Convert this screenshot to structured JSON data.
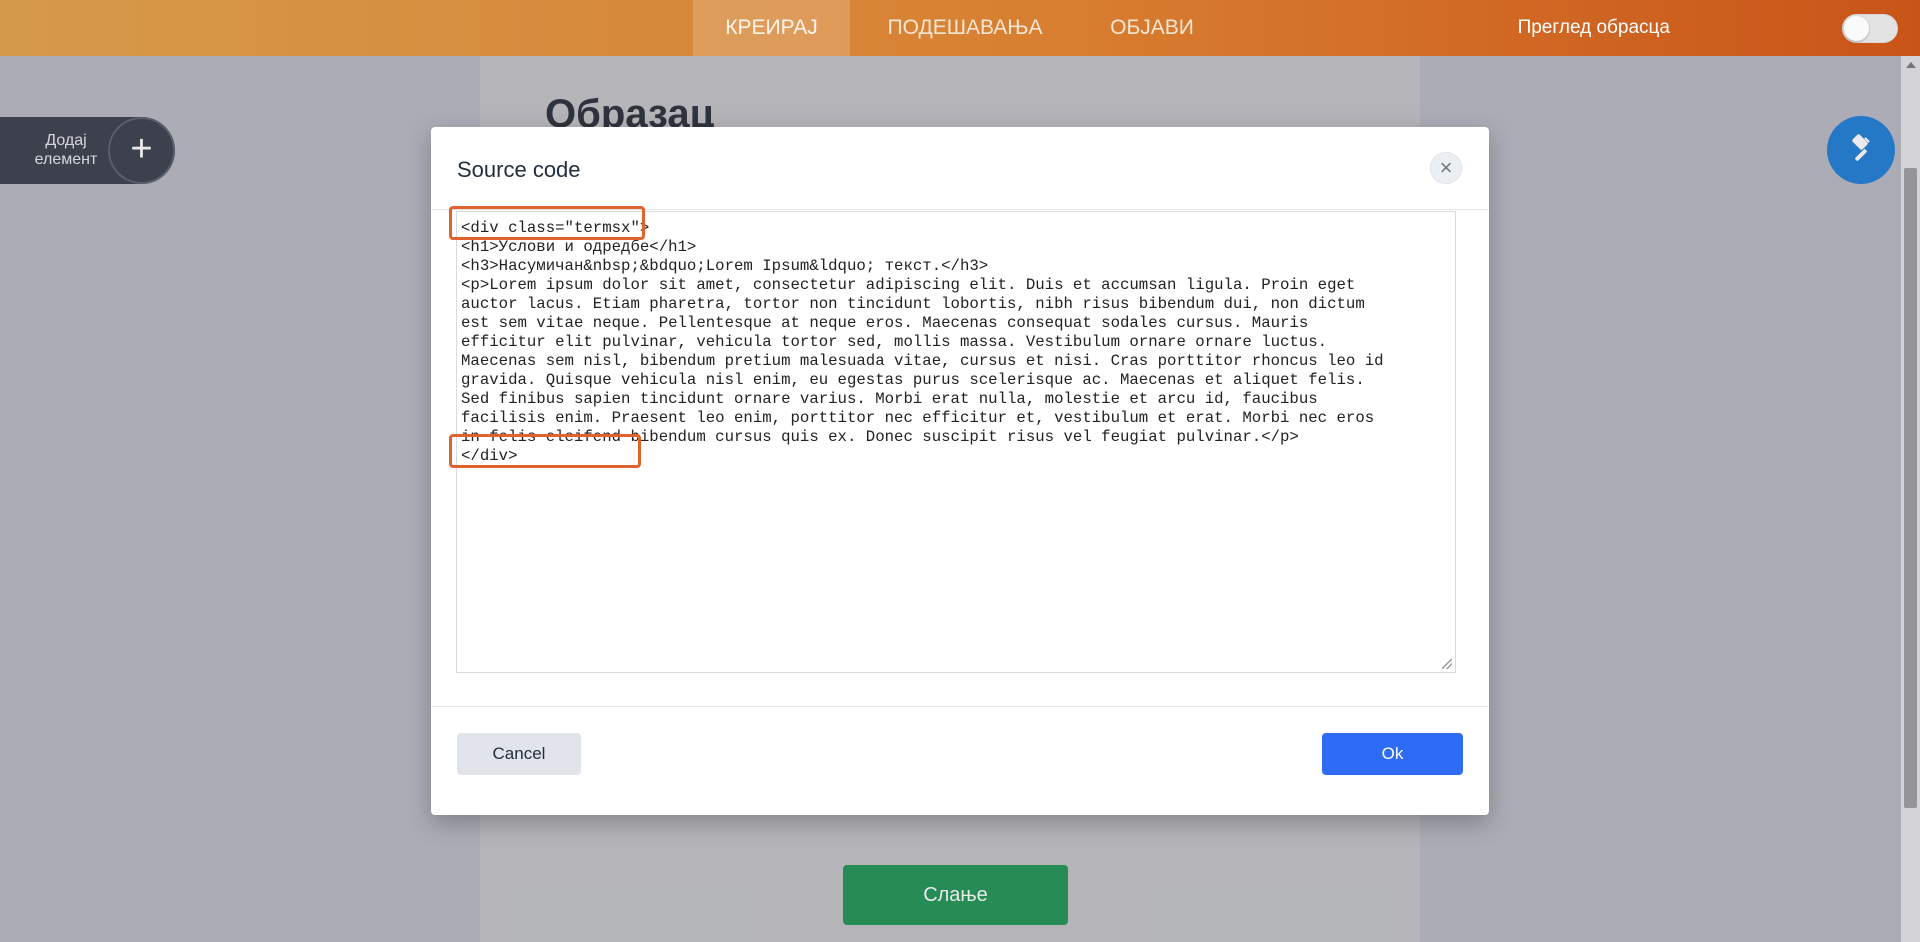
{
  "topbar": {
    "tabs": [
      {
        "label": "КРЕИРАЈ",
        "active": true
      },
      {
        "label": "ПОДЕШАВАЊА",
        "active": false
      },
      {
        "label": "ОБЈАВИ",
        "active": false
      }
    ],
    "preview_label": "Преглед обрасца",
    "preview_enabled": false
  },
  "form": {
    "title": "Образац",
    "submit_label": "Слање"
  },
  "add_element": {
    "label_line1": "Додај",
    "label_line2": "елемент",
    "icon": "plus-icon"
  },
  "paint_button": {
    "icon": "paint-roller-icon"
  },
  "modal": {
    "title": "Source code",
    "close_icon": "close-icon",
    "code_lines": [
      "<div class=\"termsx\">",
      "<h1>Услови и одредбе</h1>",
      "<h3>Насумичан&nbsp;&bdquo;Lorem Ipsum&ldquo; текст.</h3>",
      "<p>Lorem ipsum dolor sit amet, consectetur adipiscing elit. Duis et accumsan ligula. Proin eget",
      "auctor lacus. Etiam pharetra, tortor non tincidunt lobortis, nibh risus bibendum dui, non dictum",
      "est sem vitae neque. Pellentesque at neque eros. Maecenas consequat sodales cursus. Mauris",
      "efficitur elit pulvinar, vehicula tortor sed, mollis massa. Vestibulum ornare ornare luctus.",
      "Maecenas sem nisl, bibendum pretium malesuada vitae, cursus et nisi. Cras porttitor rhoncus leo id",
      "gravida. Quisque vehicula nisl enim, eu egestas purus scelerisque ac. Maecenas et aliquet felis.",
      "Sed finibus sapien tincidunt ornare varius. Morbi erat nulla, molestie et arcu id, faucibus",
      "facilisis enim. Praesent leo enim, porttitor nec efficitur et, vestibulum et erat. Morbi nec eros",
      "in felis eleifend bibendum cursus quis ex. Donec suscipit risus vel feugiat pulvinar.</p>",
      "</div>"
    ],
    "cancel_label": "Cancel",
    "ok_label": "Ok"
  },
  "colors": {
    "topbar_start": "#d59a4a",
    "topbar_end": "#c95418",
    "highlight": "#e0632e",
    "ok_button": "#2f6cf5",
    "submit_button": "#209455",
    "paint_button": "#1e7ed4"
  }
}
